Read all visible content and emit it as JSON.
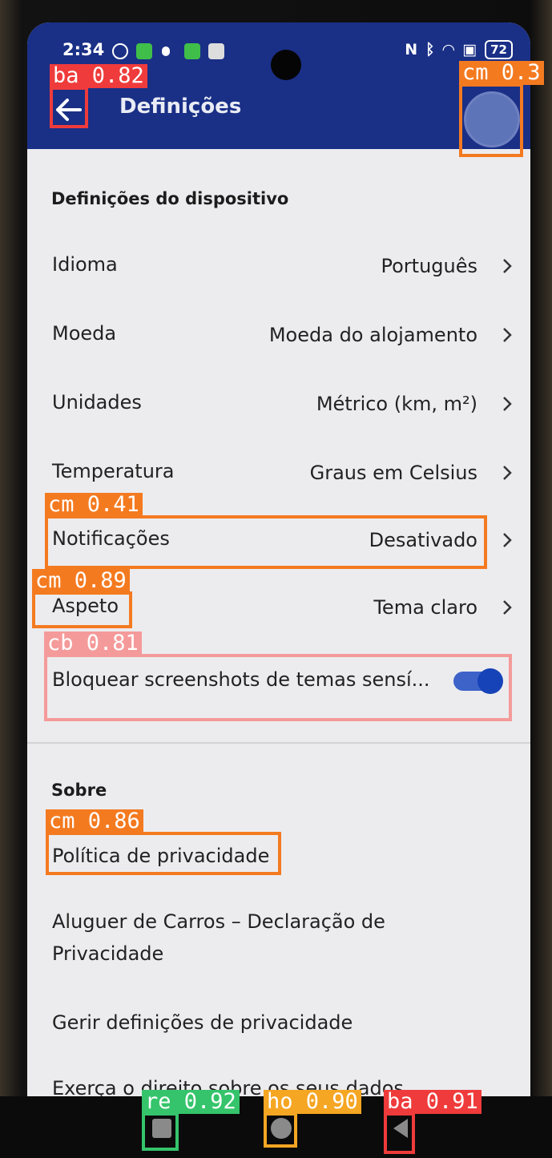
{
  "status_bar": {
    "time": "2:34",
    "battery": "72"
  },
  "header": {
    "title": "Definições"
  },
  "device_settings": {
    "title": "Definições do dispositivo",
    "rows": [
      {
        "label": "Idioma",
        "value": "Português"
      },
      {
        "label": "Moeda",
        "value": "Moeda do alojamento"
      },
      {
        "label": "Unidades",
        "value": "Métrico (km, m²)"
      },
      {
        "label": "Temperatura",
        "value": "Graus em Celsius"
      },
      {
        "label": "Notificações",
        "value": "Desativado"
      },
      {
        "label": "Aspeto",
        "value": "Tema claro"
      }
    ],
    "toggle_label": "Bloquear screenshots de temas sensí...",
    "toggle_on": true
  },
  "about": {
    "title": "Sobre",
    "links": [
      "Política de privacidade",
      "Aluguer de Carros – Declaração de Privacidade",
      "Gerir definições de privacidade",
      "Exerça o direito sobre os seus dados"
    ]
  },
  "detections": [
    {
      "tag": "ba 0.82",
      "color": "#ef3b3b"
    },
    {
      "tag": "cm 0.3",
      "color": "#f47a20"
    },
    {
      "tag": "cm 0.41",
      "color": "#f47a20"
    },
    {
      "tag": "cm 0.89",
      "color": "#f47a20"
    },
    {
      "tag": "cb 0.81",
      "color": "#f59a9a"
    },
    {
      "tag": "cm 0.86",
      "color": "#f47a20"
    },
    {
      "tag": "re 0.92",
      "color": "#35c46b"
    },
    {
      "tag": "ho 0.90",
      "color": "#f5a623"
    },
    {
      "tag": "ba 0.91",
      "color": "#ef3b3b"
    }
  ],
  "colors": {
    "appbar": "#1a2f86",
    "toggle": "#1743b8",
    "background": "#ececee"
  },
  "icons": [
    "back-arrow-icon",
    "chevron-right-icon",
    "recents-icon",
    "home-icon",
    "back-triangle-icon"
  ]
}
